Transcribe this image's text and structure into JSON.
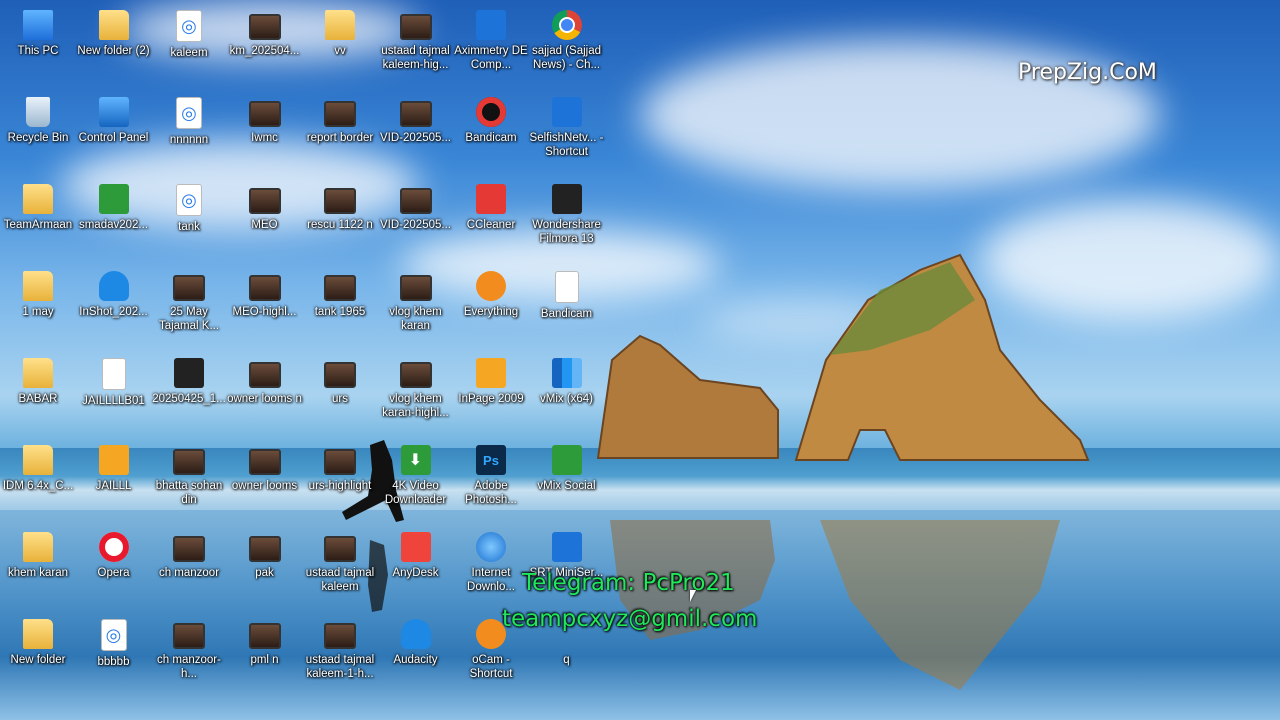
{
  "watermark": "PrepZig.CoM",
  "overlay": {
    "telegram": "Telegram: PcPro21",
    "email": "teampcxyz@gmil.com"
  },
  "icons": [
    {
      "name": "this-pc",
      "label": "This PC",
      "icon": "computer-icon"
    },
    {
      "name": "new-folder-2",
      "label": "New folder (2)",
      "icon": "folder-icon"
    },
    {
      "name": "kaleem",
      "label": "kaleem",
      "icon": "settings-file-icon"
    },
    {
      "name": "km-202504",
      "label": "km_202504...",
      "icon": "video-file-icon"
    },
    {
      "name": "vv",
      "label": "vv",
      "icon": "folder-icon"
    },
    {
      "name": "ustaad-tajmal",
      "label": "ustaad tajmal kaleem-hig...",
      "icon": "video-file-icon"
    },
    {
      "name": "aximmetry",
      "label": "Aximmetry DE Comp...",
      "icon": "aximmetry-icon"
    },
    {
      "name": "sajjad-news",
      "label": "sajjad (Sajjad News) - Ch...",
      "icon": "chrome-icon"
    },
    {
      "name": "recycle-bin",
      "label": "Recycle Bin",
      "icon": "recycle-bin-icon"
    },
    {
      "name": "control-panel",
      "label": "Control Panel",
      "icon": "control-panel-icon"
    },
    {
      "name": "nnnnnn",
      "label": "nnnnnn",
      "icon": "settings-file-icon"
    },
    {
      "name": "iwmc",
      "label": "Iwmc",
      "icon": "video-file-icon"
    },
    {
      "name": "report-border",
      "label": "report border",
      "icon": "video-file-icon"
    },
    {
      "name": "vid-202505-a",
      "label": "VID-202505...",
      "icon": "video-file-icon"
    },
    {
      "name": "bandicam",
      "label": "Bandicam",
      "icon": "bandicam-icon"
    },
    {
      "name": "selfishnetv",
      "label": "SelfishNetv... - Shortcut",
      "icon": "window-shortcut-icon"
    },
    {
      "name": "teamarmaan",
      "label": "TeamArmaan",
      "icon": "folder-icon"
    },
    {
      "name": "smadav",
      "label": "smadav202...",
      "icon": "smadav-icon"
    },
    {
      "name": "tank",
      "label": "tank",
      "icon": "settings-file-icon"
    },
    {
      "name": "meo",
      "label": "MEO",
      "icon": "video-file-icon"
    },
    {
      "name": "rescu",
      "label": "rescu 1122 n",
      "icon": "video-file-icon"
    },
    {
      "name": "vid-202505-b",
      "label": "VID-202505...",
      "icon": "video-file-icon"
    },
    {
      "name": "ccleaner",
      "label": "CCleaner",
      "icon": "ccleaner-icon"
    },
    {
      "name": "filmora",
      "label": "Wondershare Filmora 13",
      "icon": "filmora-icon"
    },
    {
      "name": "1-may",
      "label": "1 may",
      "icon": "folder-icon"
    },
    {
      "name": "inshot",
      "label": "InShot_202...",
      "icon": "headphones-icon"
    },
    {
      "name": "25-may",
      "label": "25 May Tajamal K...",
      "icon": "video-file-icon"
    },
    {
      "name": "meo-highl",
      "label": "MEO-highl...",
      "icon": "video-file-icon"
    },
    {
      "name": "tank-1965",
      "label": "tank 1965",
      "icon": "video-file-icon"
    },
    {
      "name": "vlog-khem",
      "label": "vlog khem karan",
      "icon": "video-file-icon"
    },
    {
      "name": "everything",
      "label": "Everything",
      "icon": "everything-icon"
    },
    {
      "name": "bandicam-file",
      "label": "Bandicam",
      "icon": "document-icon"
    },
    {
      "name": "babar",
      "label": "BABAR",
      "icon": "folder-icon"
    },
    {
      "name": "jailll",
      "label": "JAILLLLB01",
      "icon": "document-icon"
    },
    {
      "name": "20250425",
      "label": "20250425_1...",
      "icon": "phone-image-icon"
    },
    {
      "name": "owner-looms",
      "label": "owner looms n",
      "icon": "video-file-icon"
    },
    {
      "name": "urs",
      "label": "urs",
      "icon": "video-file-icon"
    },
    {
      "name": "vlog-khem-high",
      "label": "vlog khem karan-highl...",
      "icon": "video-file-icon"
    },
    {
      "name": "inpage-2009",
      "label": "InPage 2009",
      "icon": "inpage-icon"
    },
    {
      "name": "vmix",
      "label": "vMix (x64)",
      "icon": "vmix-icon"
    },
    {
      "name": "idm",
      "label": "IDM 6.4x_C...",
      "icon": "folder-icon"
    },
    {
      "name": "jaill",
      "label": "JAILLL",
      "icon": "inpage-icon"
    },
    {
      "name": "bhatta-sohan",
      "label": "bhatta sohan din",
      "icon": "video-file-icon"
    },
    {
      "name": "owner-looms-2",
      "label": "owner looms",
      "icon": "video-file-icon"
    },
    {
      "name": "urs-highlight",
      "label": "urs-highlight",
      "icon": "video-file-icon"
    },
    {
      "name": "4k-video",
      "label": "4K Video Downloader",
      "icon": "4k-downloader-icon"
    },
    {
      "name": "photoshop",
      "label": "Adobe Photosh...",
      "icon": "photoshop-icon"
    },
    {
      "name": "vmix-social",
      "label": "vMix Social",
      "icon": "vmix-social-icon"
    },
    {
      "name": "khem-karan",
      "label": "khem karan",
      "icon": "folder-icon"
    },
    {
      "name": "opera",
      "label": "Opera",
      "icon": "opera-icon"
    },
    {
      "name": "ch-manzoor",
      "label": "ch manzoor",
      "icon": "video-file-icon"
    },
    {
      "name": "pak",
      "label": "pak",
      "icon": "video-file-icon"
    },
    {
      "name": "ustaad-tajmal-2",
      "label": "ustaad tajmal kaleem",
      "icon": "video-file-icon"
    },
    {
      "name": "anydesk",
      "label": "AnyDesk",
      "icon": "anydesk-icon"
    },
    {
      "name": "internet-download",
      "label": "Internet Downlo...",
      "icon": "idm-icon"
    },
    {
      "name": "srt-miniserver",
      "label": "SRT MiniSer...",
      "icon": "srt-icon"
    },
    {
      "name": "new-folder",
      "label": "New folder",
      "icon": "folder-icon"
    },
    {
      "name": "bbbbb",
      "label": "bbbbb",
      "icon": "settings-file-icon"
    },
    {
      "name": "ch-manzoor-h",
      "label": "ch manzoor-h...",
      "icon": "video-file-icon"
    },
    {
      "name": "pml-n",
      "label": "pml n",
      "icon": "video-file-icon"
    },
    {
      "name": "ustaad-tajmal-1",
      "label": "ustaad tajmal kaleem-1-h...",
      "icon": "video-file-icon"
    },
    {
      "name": "audacity",
      "label": "Audacity",
      "icon": "audacity-icon"
    },
    {
      "name": "ocam",
      "label": "oCam - Shortcut",
      "icon": "ocam-icon"
    },
    {
      "name": "q",
      "label": "q",
      "icon": "blank-icon"
    }
  ]
}
